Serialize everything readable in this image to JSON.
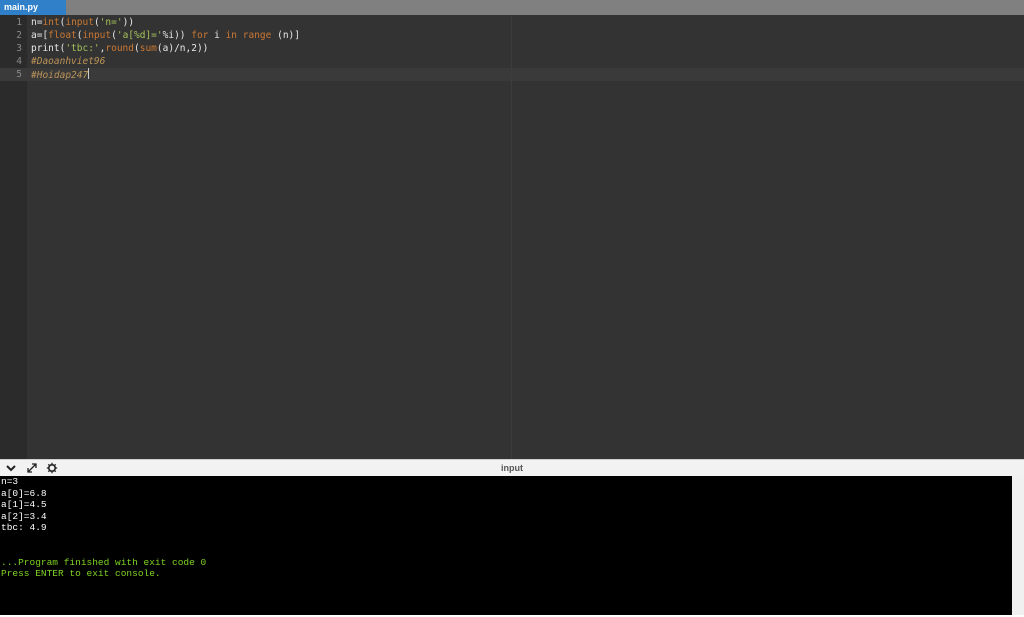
{
  "tab": {
    "label": "main.py",
    "accent": "#2f7fc9"
  },
  "editor": {
    "lines": [
      {
        "num": "1",
        "tokens": [
          {
            "text": "n=",
            "kind": "plain"
          },
          {
            "text": "int",
            "kind": "kw"
          },
          {
            "text": "(",
            "kind": "plain"
          },
          {
            "text": "input",
            "kind": "kw"
          },
          {
            "text": "(",
            "kind": "plain"
          },
          {
            "text": "'n='",
            "kind": "str"
          },
          {
            "text": "))",
            "kind": "plain"
          }
        ]
      },
      {
        "num": "2",
        "tokens": [
          {
            "text": "a=[",
            "kind": "plain"
          },
          {
            "text": "float",
            "kind": "kw"
          },
          {
            "text": "(",
            "kind": "plain"
          },
          {
            "text": "input",
            "kind": "kw"
          },
          {
            "text": "(",
            "kind": "plain"
          },
          {
            "text": "'a[%d]='",
            "kind": "str"
          },
          {
            "text": "%i)) ",
            "kind": "plain"
          },
          {
            "text": "for",
            "kind": "kw"
          },
          {
            "text": " i ",
            "kind": "plain"
          },
          {
            "text": "in",
            "kind": "kw"
          },
          {
            "text": " ",
            "kind": "plain"
          },
          {
            "text": "range",
            "kind": "kw"
          },
          {
            "text": " (n)]",
            "kind": "plain"
          }
        ]
      },
      {
        "num": "3",
        "tokens": [
          {
            "text": "print(",
            "kind": "plain"
          },
          {
            "text": "'tbc:'",
            "kind": "str"
          },
          {
            "text": ",",
            "kind": "plain"
          },
          {
            "text": "round",
            "kind": "kw"
          },
          {
            "text": "(",
            "kind": "plain"
          },
          {
            "text": "sum",
            "kind": "kw"
          },
          {
            "text": "(a)/n,2))",
            "kind": "plain"
          }
        ]
      },
      {
        "num": "4",
        "tokens": [
          {
            "text": "#Daoanhviet96",
            "kind": "cm"
          }
        ]
      },
      {
        "num": "5",
        "tokens": [
          {
            "text": "#Hoidap247",
            "kind": "cm"
          }
        ],
        "cursor": true
      }
    ],
    "colors": {
      "background": "#333333",
      "keyword": "#cc7832",
      "string": "#a5c25c",
      "comment": "#bc9458"
    }
  },
  "console_toolbar": {
    "title": "input",
    "icons": [
      "chevron-down-icon",
      "expand-icon",
      "settings-icon"
    ]
  },
  "console": {
    "lines": [
      {
        "text": "n=3",
        "color": "#ffffff"
      },
      {
        "text": "a[0]=6.8",
        "color": "#ffffff"
      },
      {
        "text": "a[1]=4.5",
        "color": "#ffffff"
      },
      {
        "text": "a[2]=3.4",
        "color": "#ffffff"
      },
      {
        "text": "tbc: 4.9",
        "color": "#ffffff"
      },
      {
        "text": "",
        "color": "#ffffff"
      },
      {
        "text": "",
        "color": "#ffffff"
      },
      {
        "text": "...Program finished with exit code 0",
        "color": "#7ed321"
      },
      {
        "text": "Press ENTER to exit console.",
        "color": "#7ed321"
      }
    ]
  }
}
